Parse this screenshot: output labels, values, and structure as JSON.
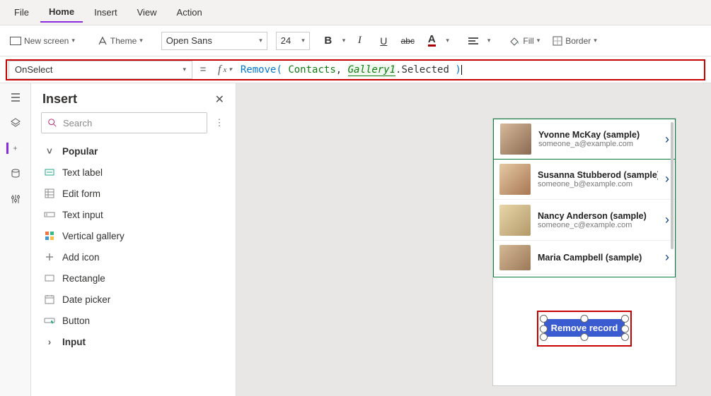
{
  "tabs": [
    "File",
    "Home",
    "Insert",
    "View",
    "Action"
  ],
  "active_tab": "Home",
  "ribbon": {
    "new_screen": "New screen",
    "theme": "Theme",
    "font_name": "Open Sans",
    "font_size": "24",
    "fill": "Fill",
    "border": "Border"
  },
  "formula": {
    "property": "OnSelect",
    "fn": "Remove",
    "datasource": "Contacts",
    "gallery": "Gallery1",
    "selected": ".Selected"
  },
  "insert_panel": {
    "title": "Insert",
    "search_placeholder": "Search",
    "section": "Popular",
    "items": [
      "Text label",
      "Edit form",
      "Text input",
      "Vertical gallery",
      "Add icon",
      "Rectangle",
      "Date picker",
      "Button"
    ],
    "input_section": "Input"
  },
  "gallery": [
    {
      "name": "Yvonne McKay (sample)",
      "email": "someone_a@example.com"
    },
    {
      "name": "Susanna Stubberod (sample)",
      "email": "someone_b@example.com"
    },
    {
      "name": "Nancy Anderson (sample)",
      "email": "someone_c@example.com"
    },
    {
      "name": "Maria Campbell (sample)",
      "email": ""
    }
  ],
  "remove_button": "Remove record"
}
